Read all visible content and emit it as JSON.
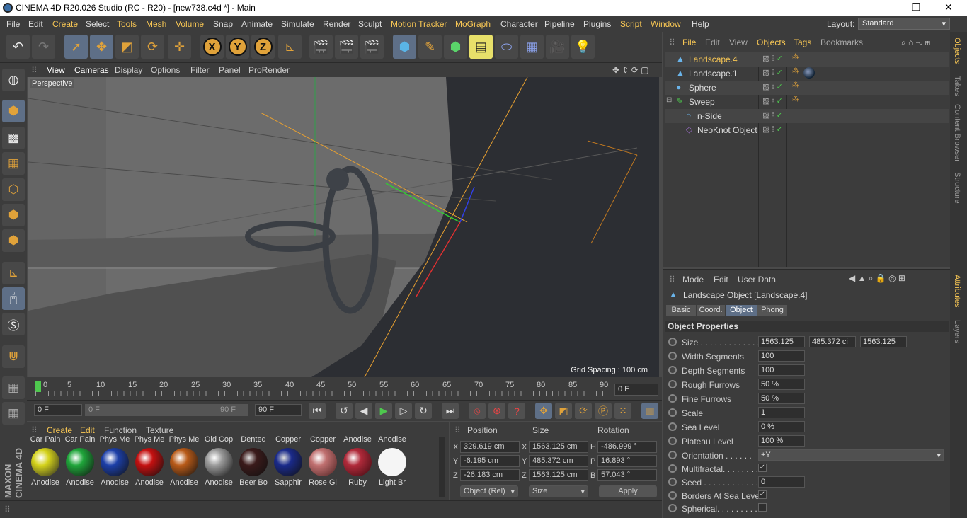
{
  "window": {
    "title": "CINEMA 4D R20.026 Studio (RC - R20) - [new738.c4d *] - Main",
    "min": "—",
    "max": "❐",
    "close": "✕"
  },
  "menu": [
    "File",
    "Edit",
    "Create",
    "Select",
    "Tools",
    "Mesh",
    "Volume",
    "Snap",
    "Animate",
    "Simulate",
    "Render",
    "Sculpt",
    "Motion Tracker",
    "MoGraph",
    "Character",
    "Pipeline",
    "Plugins",
    "Script",
    "Window",
    "Help"
  ],
  "layout": {
    "label": "Layout:",
    "value": "Standard"
  },
  "viewport": {
    "menu": [
      "View",
      "Cameras",
      "Display",
      "Options",
      "Filter",
      "Panel",
      "ProRender"
    ],
    "camera": "Perspective",
    "grid": "Grid Spacing : 100 cm"
  },
  "timeline": {
    "ticks": [
      "0",
      "5",
      "10",
      "15",
      "20",
      "25",
      "30",
      "35",
      "40",
      "45",
      "50",
      "55",
      "60",
      "65",
      "70",
      "75",
      "80",
      "85",
      "90"
    ],
    "frame": "0 F",
    "start": "0 F",
    "range_start": "0 F",
    "range_end": "90 F",
    "end": "90 F"
  },
  "materials": {
    "menu": [
      "Create",
      "Edit",
      "Function",
      "Texture"
    ],
    "top": [
      "Car Pain",
      "Car Pain",
      "Phys Me",
      "Phys Me",
      "Phys Me",
      "Old Cop",
      "Dented",
      "Copper",
      "Copper",
      "Anodise",
      "Anodise"
    ],
    "items": [
      {
        "name": "Anodise",
        "color": "#d4d21a"
      },
      {
        "name": "Anodise",
        "color": "#1fa53a"
      },
      {
        "name": "Anodise",
        "color": "#1c3fa8"
      },
      {
        "name": "Anodise",
        "color": "#c41010"
      },
      {
        "name": "Anodise",
        "color": "#b85a18"
      },
      {
        "name": "Anodise",
        "color": "#9a9a9a"
      },
      {
        "name": "Beer Bo",
        "color": "#3a1a1a"
      },
      {
        "name": "Sapphir",
        "color": "#1a2a8a"
      },
      {
        "name": "Rose Gl",
        "color": "#c07070"
      },
      {
        "name": "Ruby",
        "color": "#b02a3a"
      },
      {
        "name": "Light Br",
        "color": "#f5f5f5"
      }
    ]
  },
  "coords": {
    "headers": [
      "Position",
      "Size",
      "Rotation"
    ],
    "rows": [
      {
        "axis": "X",
        "pos": "329.619 cm",
        "saxis": "X",
        "size": "1563.125 cm",
        "raxis": "H",
        "rot": "-486.999 °"
      },
      {
        "axis": "Y",
        "pos": "-6.195 cm",
        "saxis": "Y",
        "size": "485.372 cm",
        "raxis": "P",
        "rot": "16.893 °"
      },
      {
        "axis": "Z",
        "pos": "-26.183 cm",
        "saxis": "Z",
        "size": "1563.125 cm",
        "raxis": "B",
        "rot": "57.043 °"
      }
    ],
    "mode": "Object (Rel)",
    "sizemode": "Size",
    "apply": "Apply"
  },
  "objects": {
    "menu": [
      "File",
      "Edit",
      "View",
      "Objects",
      "Tags",
      "Bookmarks"
    ],
    "items": [
      {
        "name": "Landscape.4",
        "indent": 0
      },
      {
        "name": "Landscape.1",
        "indent": 0
      },
      {
        "name": "Sphere",
        "indent": 0
      },
      {
        "name": "Sweep",
        "indent": 0
      },
      {
        "name": "n-Side",
        "indent": 1
      },
      {
        "name": "NeoKnot Object",
        "indent": 1
      }
    ]
  },
  "attributes": {
    "menu": [
      "Mode",
      "Edit",
      "User Data"
    ],
    "object": "Landscape Object [Landscape.4]",
    "tabs": [
      "Basic",
      "Coord.",
      "Object",
      "Phong"
    ],
    "section": "Object Properties",
    "size": [
      "1563.125",
      "485.372 ci",
      "1563.125"
    ],
    "props": [
      {
        "label": "Width Segments",
        "value": "100"
      },
      {
        "label": "Depth Segments",
        "value": "100"
      },
      {
        "label": "Rough Furrows",
        "value": "50 %"
      },
      {
        "label": "Fine Furrows",
        "value": "50 %"
      },
      {
        "label": "Scale",
        "value": "1"
      },
      {
        "label": "Sea Level",
        "value": "0 %"
      },
      {
        "label": "Plateau Level",
        "value": "100 %"
      }
    ],
    "orientation": "+Y",
    "seed": "0",
    "labels": {
      "size": "Size . . . . . . . . . . . . .",
      "orientation": "Orientation . . . . . .",
      "multifractal": "Multifractal. . . . . . . .",
      "seed": "Seed . . . . . . . . . . . .",
      "borders": "Borders At Sea Level",
      "spherical": "Spherical. . . . . . . . ."
    }
  },
  "sidetabs": {
    "right_top": [
      "Objects",
      "Takes",
      "Content Browser",
      "Structure"
    ],
    "right_bottom": [
      "Attributes",
      "Layers"
    ]
  }
}
